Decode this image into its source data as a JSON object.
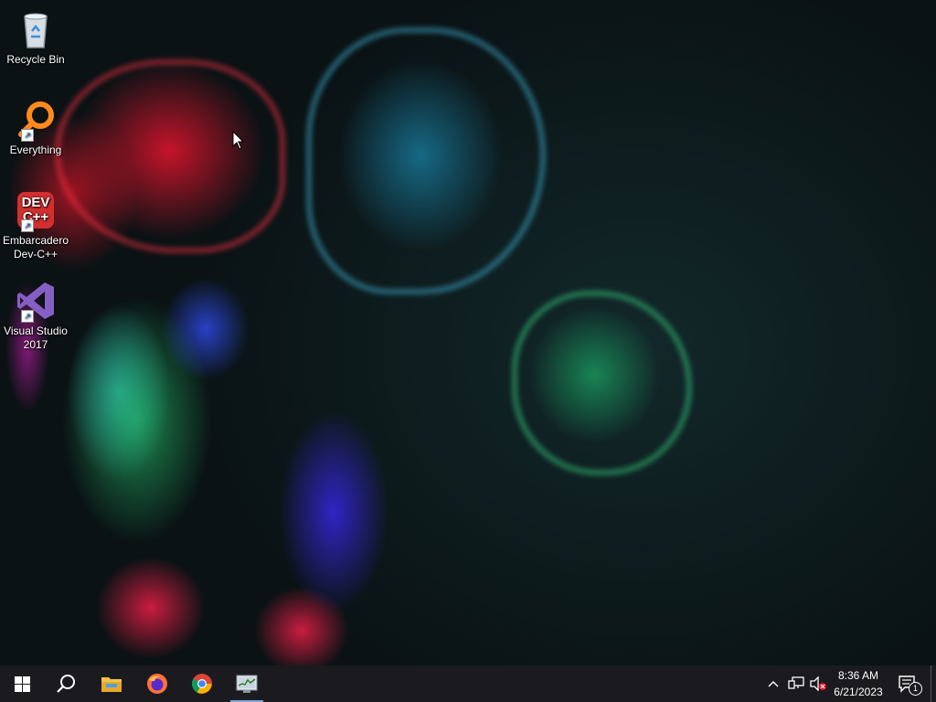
{
  "desktop": {
    "icons": [
      {
        "label_line1": "Recycle Bin",
        "label_line2": "",
        "icon": "recycle-bin-icon"
      },
      {
        "label_line1": "Everything",
        "label_line2": "",
        "icon": "everything-search-icon"
      },
      {
        "label_line1": "Embarcadero",
        "label_line2": "Dev-C++",
        "icon": "devcpp-icon",
        "icon_text_top": "DEV",
        "icon_text_bottom": "C++"
      },
      {
        "label_line1": "Visual Studio",
        "label_line2": "2017",
        "icon": "visual-studio-icon"
      }
    ],
    "shortcut_glyph": "↗"
  },
  "taskbar": {
    "apps": [
      {
        "name": "start-button",
        "icon": "windows-logo-icon"
      },
      {
        "name": "search-button",
        "icon": "search-icon"
      },
      {
        "name": "file-explorer",
        "icon": "folder-icon"
      },
      {
        "name": "firefox",
        "icon": "firefox-icon"
      },
      {
        "name": "chrome",
        "icon": "chrome-icon"
      },
      {
        "name": "active-app",
        "icon": "task-manager-icon",
        "active": true
      }
    ],
    "tray": {
      "chevron": "^",
      "network_icon": "network-icon",
      "volume_icon": "volume-muted-icon"
    },
    "clock": {
      "time": "8:36 AM",
      "date": "6/21/2023"
    },
    "notifications": {
      "count": "1",
      "icon": "action-center-icon"
    }
  },
  "colors": {
    "taskbar_bg": "#1b1b1f",
    "active_indicator": "#7aa7d8",
    "devcpp_red": "#d32f2f",
    "vs_purple": "#865fc5"
  }
}
